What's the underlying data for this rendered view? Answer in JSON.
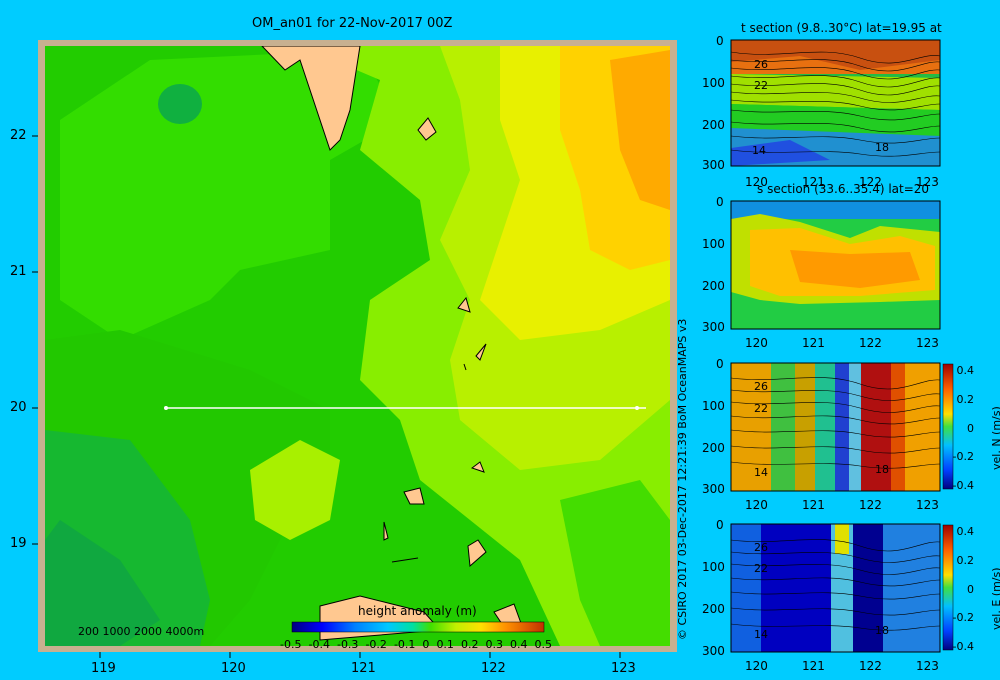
{
  "main_map": {
    "title": "OM_an01 for 22-Nov-2017 00Z",
    "x_ticks": [
      "119",
      "120",
      "121",
      "122",
      "123"
    ],
    "y_ticks": [
      "22",
      "21",
      "20",
      "19"
    ],
    "depth_legend": "200  1000  2000  4000m",
    "colorbar": {
      "label": "height anomaly (m)",
      "ticks": [
        "-0.5",
        "-0.4",
        "-0.3",
        "-0.2",
        "-0.1",
        "0",
        "0.1",
        "0.2",
        "0.3",
        "0.4",
        "0.5"
      ]
    },
    "section_line": {
      "lat": 20,
      "lon_start": 119.5,
      "lon_end": 123.2
    }
  },
  "credit": "© CSIRO 2017   03-Dec-2017 12:21:39 BoM OceanMAPS v3",
  "panels": [
    {
      "id": "temp",
      "title": "t section (9.8..30°C) lat=19.95 at",
      "y_ticks": [
        "0",
        "100",
        "200",
        "300"
      ],
      "x_ticks": [
        "120",
        "121",
        "122",
        "123"
      ],
      "contour_labels": [
        "26",
        "22",
        "14",
        "18"
      ]
    },
    {
      "id": "salt",
      "title": "s section (33.6..35.4) lat=20",
      "y_ticks": [
        "0",
        "100",
        "200",
        "300"
      ],
      "x_ticks": [
        "120",
        "121",
        "122",
        "123"
      ],
      "contour_labels": []
    },
    {
      "id": "veln",
      "title": "",
      "y_ticks": [
        "0",
        "100",
        "200",
        "300"
      ],
      "x_ticks": [
        "120",
        "121",
        "122",
        "123"
      ],
      "contour_labels": [
        "26",
        "22",
        "14",
        "18"
      ],
      "colorbar": {
        "label": "vel. N (m/s)",
        "ticks": [
          "0.4",
          "0.2",
          "0",
          "-0.2",
          "-0.4"
        ]
      }
    },
    {
      "id": "vele",
      "title": "",
      "y_ticks": [
        "0",
        "100",
        "200",
        "300"
      ],
      "x_ticks": [
        "120",
        "121",
        "122",
        "123"
      ],
      "contour_labels": [
        "26",
        "22",
        "14",
        "18"
      ],
      "colorbar": {
        "label": "vel. E (m/s)",
        "ticks": [
          "0.4",
          "0.2",
          "0",
          "-0.2",
          "-0.4"
        ]
      }
    }
  ]
}
